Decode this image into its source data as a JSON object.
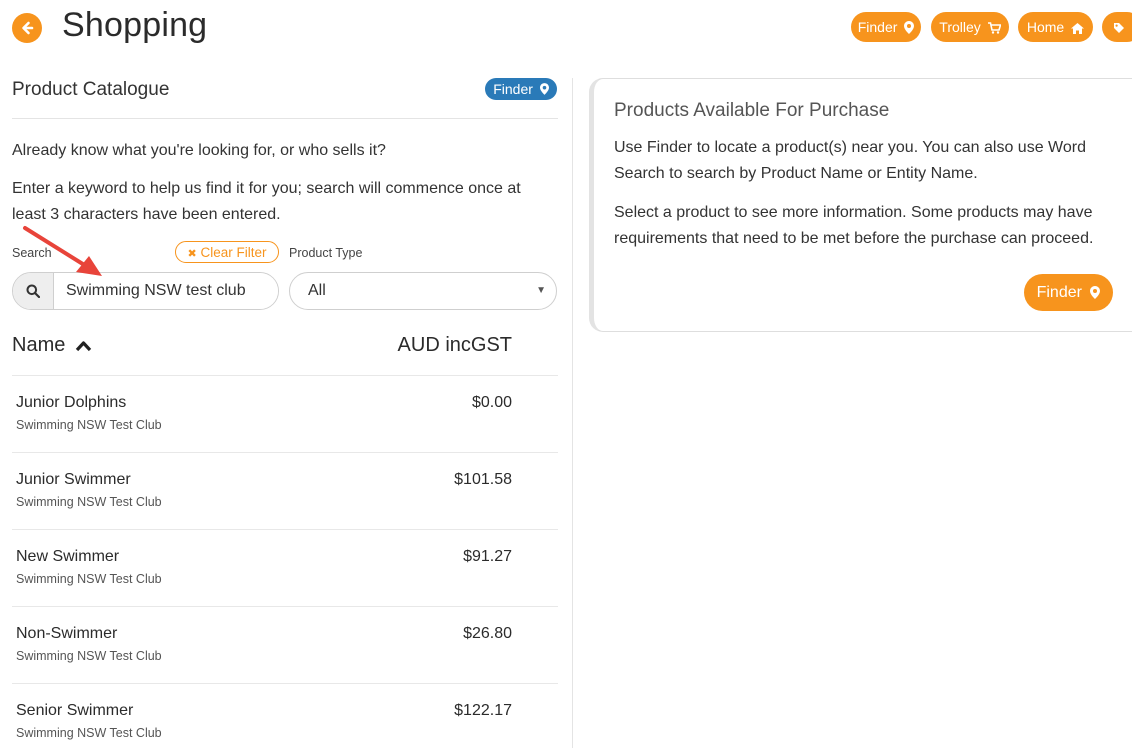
{
  "header": {
    "title": "Shopping",
    "buttons": {
      "finder": "Finder",
      "trolley": "Trolley",
      "home": "Home"
    }
  },
  "catalogue": {
    "title": "Product Catalogue",
    "finder_badge": "Finder",
    "intro": "Already know what you're looking for, or who sells it?",
    "instructions": "Enter a keyword to help us find it for you; search will commence once at least 3 characters have been entered.",
    "search_label": "Search",
    "clear_filter": "Clear Filter",
    "product_type_label": "Product Type",
    "search_value": "Swimming NSW test club",
    "product_type_value": "All",
    "columns": {
      "name": "Name",
      "price": "AUD incGST"
    },
    "rows": [
      {
        "name": "Junior Dolphins",
        "seller": "Swimming NSW Test Club",
        "price": "$0.00"
      },
      {
        "name": "Junior Swimmer",
        "seller": "Swimming NSW Test Club",
        "price": "$101.58"
      },
      {
        "name": "New Swimmer",
        "seller": "Swimming NSW Test Club",
        "price": "$91.27"
      },
      {
        "name": "Non-Swimmer",
        "seller": "Swimming NSW Test Club",
        "price": "$26.80"
      },
      {
        "name": "Senior Swimmer",
        "seller": "Swimming NSW Test Club",
        "price": "$122.17"
      }
    ]
  },
  "info": {
    "title": "Products Available For Purchase",
    "p1": "Use Finder to locate a product(s) near you. You can also use Word Search to search by Product Name or Entity Name.",
    "p2": "Select a product to see more information. Some products may have requirements that need to be met before the purchase can proceed.",
    "finder_button": "Finder"
  },
  "colors": {
    "accent": "#f7941d",
    "badge_blue": "#2a7ab8",
    "annotation_arrow": "#e8443a"
  }
}
